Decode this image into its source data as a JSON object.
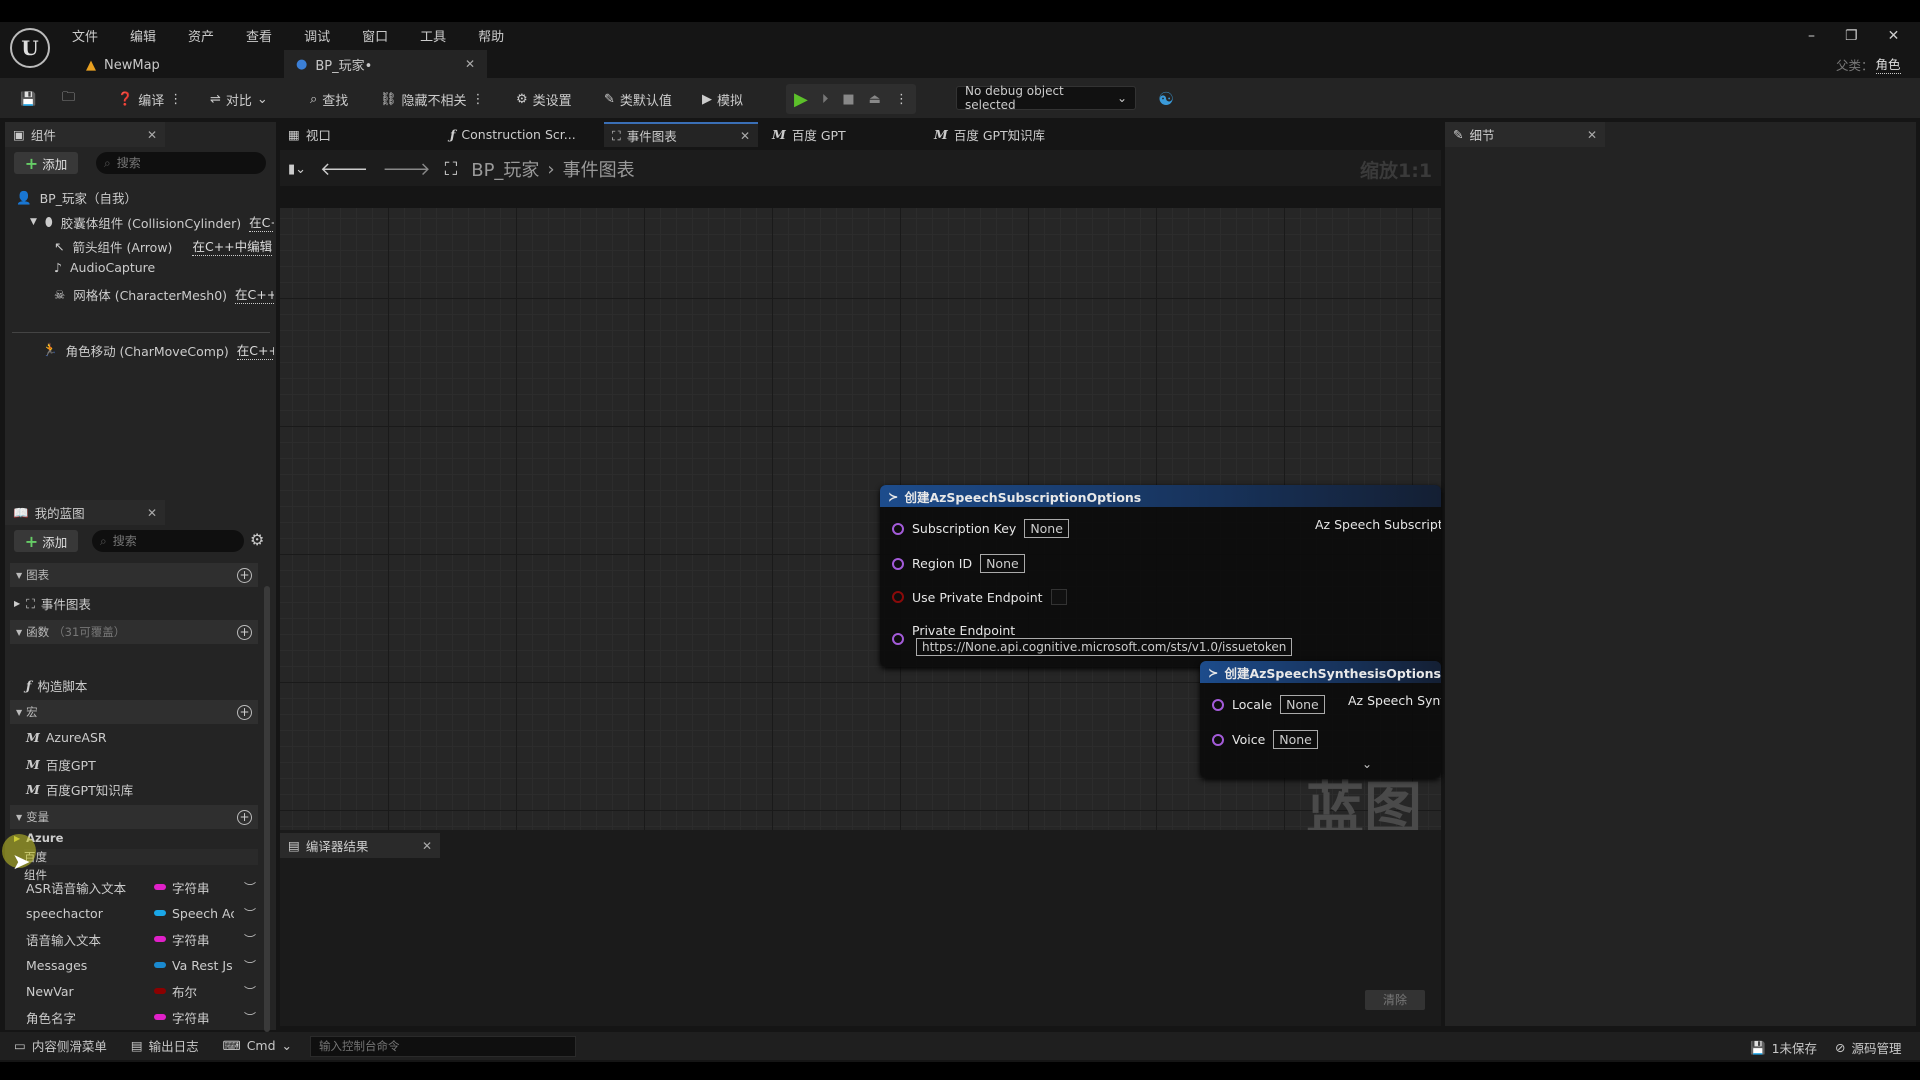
{
  "menu": [
    "文件",
    "编辑",
    "资产",
    "查看",
    "调试",
    "窗口",
    "工具",
    "帮助"
  ],
  "doc_tabs": [
    {
      "label": "NewMap"
    },
    {
      "label": "BP_玩家•"
    }
  ],
  "parent_class": {
    "label": "父类：",
    "value": "角色"
  },
  "toolbar": {
    "compile": "编译",
    "diff": "对比",
    "find": "查找",
    "hide_unrelated": "隐藏不相关",
    "class_settings": "类设置",
    "class_defaults": "类默认值",
    "simulate": "模拟",
    "debug_object": "No debug object selected"
  },
  "components": {
    "title": "组件",
    "add": "添加",
    "search_placeholder": "搜索",
    "items": [
      {
        "label": "BP_玩家（自我）",
        "link": ""
      },
      {
        "label": "胶囊体组件 (CollisionCylinder)",
        "link": "在C+"
      },
      {
        "label": "箭头组件 (Arrow)",
        "link": "在C++中编辑"
      },
      {
        "label": "AudioCapture",
        "link": ""
      },
      {
        "label": "网格体 (CharacterMesh0)",
        "link": "在C++中"
      },
      {
        "label": "角色移动 (CharMoveComp)",
        "link": "在C++中"
      }
    ]
  },
  "editor_tabs": [
    {
      "label": "视口"
    },
    {
      "label": "Construction Scr..."
    },
    {
      "label": "事件图表"
    },
    {
      "label": "百度 GPT"
    },
    {
      "label": "百度 GPT知识库"
    }
  ],
  "breadcrumb": {
    "root": "BP_玩家",
    "current": "事件图表",
    "zoom": "缩放1:1"
  },
  "graph_watermark": "蓝图",
  "node1": {
    "title": "创建AzSpeechSubscriptionOptions",
    "output": "Az Speech Subscription",
    "pins": [
      {
        "label": "Subscription Key",
        "value": "None"
      },
      {
        "label": "Region ID",
        "value": "None"
      },
      {
        "label": "Use Private Endpoint",
        "value": ""
      },
      {
        "label": "Private Endpoint",
        "value": "https://None.api.cognitive.microsoft.com/sts/v1.0/issuetoken"
      }
    ]
  },
  "node2": {
    "title": "创建AzSpeechSynthesisOptions",
    "output": "Az Speech Synthe",
    "pins": [
      {
        "label": "Locale",
        "value": "None"
      },
      {
        "label": "Voice",
        "value": "None"
      }
    ]
  },
  "details": {
    "title": "细节"
  },
  "my_blueprint": {
    "title": "我的蓝图",
    "add": "添加",
    "search_placeholder": "搜索",
    "graphs": {
      "header": "图表",
      "items": [
        "事件图表"
      ]
    },
    "functions": {
      "header": "函数",
      "note": "（31可覆盖）",
      "items": [
        "构造脚本"
      ]
    },
    "macros": {
      "header": "宏",
      "items": [
        "AzureASR",
        "百度GPT",
        "百度GPT知识库"
      ]
    },
    "variables": {
      "header": "变量",
      "categories": [
        "Azure",
        "百度",
        "组件"
      ],
      "items": [
        {
          "name": "ASR语音输入文本",
          "type": "字符串",
          "color": "#e020c8"
        },
        {
          "name": "speechactor",
          "type": "Speech Ac",
          "color": "#1aa7e8"
        },
        {
          "name": "语音输入文本",
          "type": "字符串",
          "color": "#e020c8"
        },
        {
          "name": "Messages",
          "type": "Va Rest Js",
          "color": "#1a8ad0"
        },
        {
          "name": "NewVar",
          "type": "布尔",
          "color": "#8b0000"
        },
        {
          "name": "角色名字",
          "type": "字符串",
          "color": "#e020c8"
        }
      ]
    }
  },
  "compiler": {
    "title": "编译器结果",
    "clear": "清除"
  },
  "status": {
    "content_drawer": "内容侧滑菜单",
    "output_log": "输出日志",
    "cmd": "Cmd",
    "console_placeholder": "输入控制台命令",
    "unsaved": "1未保存",
    "source_control": "源码管理"
  }
}
